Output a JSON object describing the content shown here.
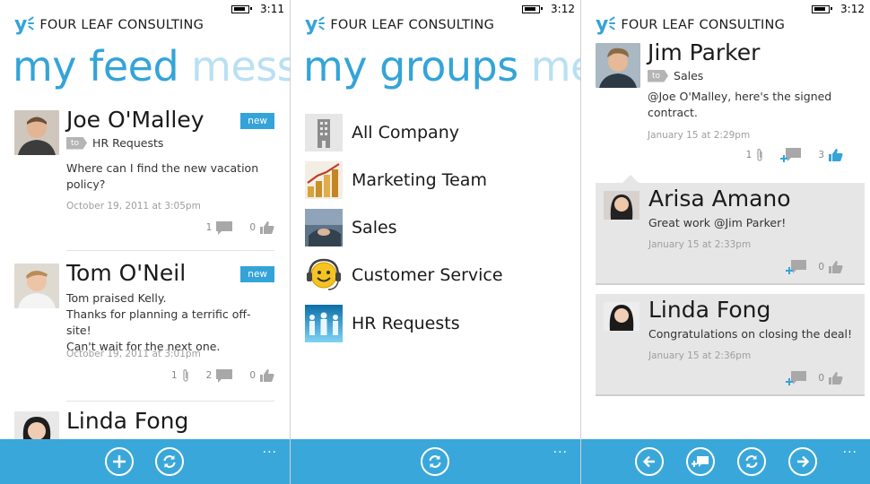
{
  "brand": {
    "name": "FOUR LEAF CONSULTING",
    "logo_glyph": "y"
  },
  "colors": {
    "accent": "#34a4d8",
    "appbar": "#3aa7da",
    "card": "#e6e6e6"
  },
  "screens": [
    {
      "status_time": "3:11",
      "pivot_current": "my feed",
      "pivot_next": "messa",
      "posts": [
        {
          "name": "Joe O'Malley",
          "badge": "new",
          "to_label": "to",
          "to": "HR Requests",
          "body": [
            "Where can I find the new vacation",
            "policy?"
          ],
          "time": "October 19, 2011 at 3:05pm",
          "attachments": "",
          "comments": "1",
          "likes": "0"
        },
        {
          "name": "Tom O'Neil",
          "badge": "new",
          "to_label": "",
          "to": "",
          "body": [
            "Tom praised Kelly.",
            "Thanks for planning a terrific off-site!",
            "Can't wait for the next one."
          ],
          "time": "October 19, 2011 at 3:01pm",
          "attachments": "1",
          "comments": "2",
          "likes": "0"
        },
        {
          "name": "Linda Fong"
        }
      ],
      "appbar": {
        "buttons": [
          "add-icon",
          "refresh-icon"
        ],
        "more": "..."
      }
    },
    {
      "status_time": "3:12",
      "pivot_current": "my groups",
      "pivot_next": "me",
      "groups": [
        "All Company",
        "Marketing Team",
        "Sales",
        "Customer Service",
        "HR Requests"
      ],
      "appbar": {
        "buttons": [
          "refresh-icon"
        ],
        "more": "..."
      }
    },
    {
      "status_time": "3:12",
      "thread": {
        "name": "Jim Parker",
        "to_label": "to",
        "to": "Sales",
        "body": [
          "@Joe O'Malley, here's the signed",
          "contract."
        ],
        "time": "January 15 at 2:29pm",
        "attachments": "1",
        "likes": "3"
      },
      "replies": [
        {
          "name": "Arisa Amano",
          "body": "Great work @Jim Parker!",
          "time": "January 15 at 2:33pm",
          "likes": "0"
        },
        {
          "name": "Linda Fong",
          "body": "Congratulations on closing the deal!",
          "time": "January 15 at 2:36pm",
          "likes": "0"
        }
      ],
      "appbar": {
        "buttons": [
          "back-icon",
          "reply-icon",
          "refresh-icon",
          "forward-icon"
        ],
        "more": "..."
      }
    }
  ]
}
